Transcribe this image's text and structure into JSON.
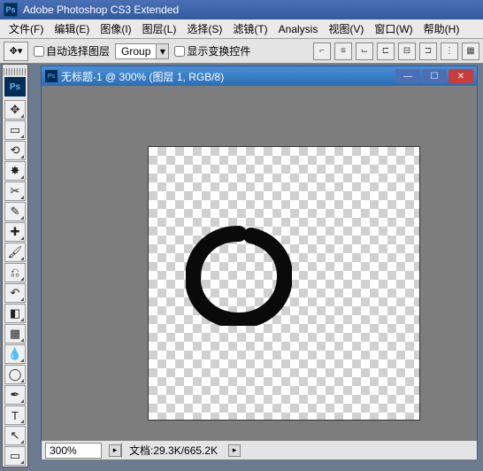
{
  "app": {
    "title": "Adobe Photoshop CS3 Extended"
  },
  "menu": {
    "file": "文件(F)",
    "edit": "编辑(E)",
    "image": "图像(I)",
    "layer": "图层(L)",
    "select": "选择(S)",
    "filter": "滤镜(T)",
    "analysis": "Analysis",
    "view": "视图(V)",
    "window": "窗口(W)",
    "help": "帮助(H)"
  },
  "options": {
    "auto_select_label": "自动选择图层",
    "group_label": "Group",
    "transform_label": "显示变换控件"
  },
  "document": {
    "title": "无标题-1 @ 300% (图层 1, RGB/8)"
  },
  "statusbar": {
    "zoom": "300%",
    "doc_label": "文档:",
    "doc_size": "29.3K/665.2K"
  },
  "tool_tip": "▸"
}
